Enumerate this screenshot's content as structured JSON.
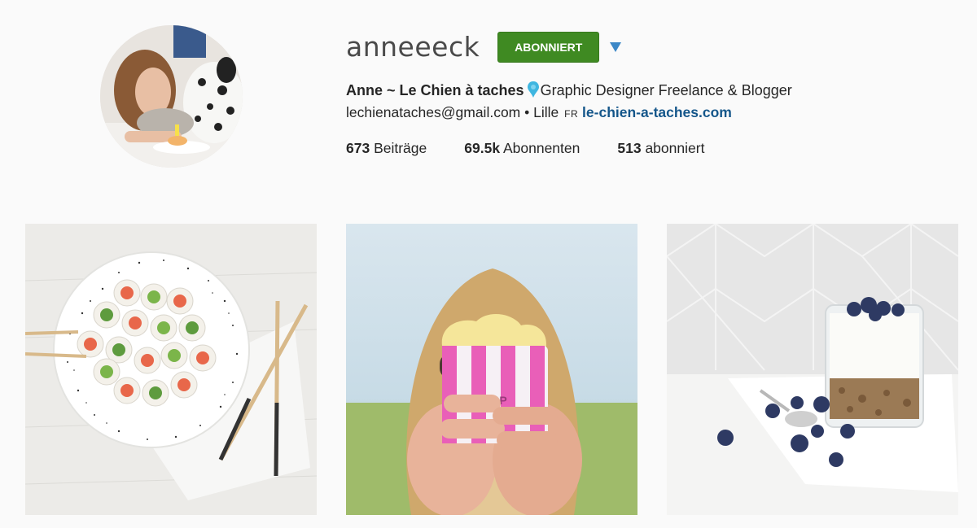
{
  "profile": {
    "username": "anneeeck",
    "follow_label": "ABONNIERT",
    "full_name": "Anne ~ Le Chien à taches",
    "description": "Graphic Designer Freelance & Blogger",
    "email": "lechienataches@gmail.com",
    "separator": "•",
    "location": "Lille",
    "lang": "FR",
    "website": "le-chien-a-taches.com"
  },
  "stats": [
    {
      "value": "673",
      "label": "Beiträge"
    },
    {
      "value": "69.5k",
      "label": "Abonnenten"
    },
    {
      "value": "513",
      "label": "abonniert"
    }
  ],
  "posts": [
    {
      "name": "sushi-rolls-post",
      "pop_text": ""
    },
    {
      "name": "popcorn-phone-post",
      "pop_text": "POP"
    },
    {
      "name": "blueberry-yogurt-post",
      "pop_text": ""
    }
  ],
  "colors": {
    "follow_button": "#3f8a22",
    "link": "#14568a",
    "dropdown": "#3c88c7",
    "pin": "#3fb6e0"
  }
}
